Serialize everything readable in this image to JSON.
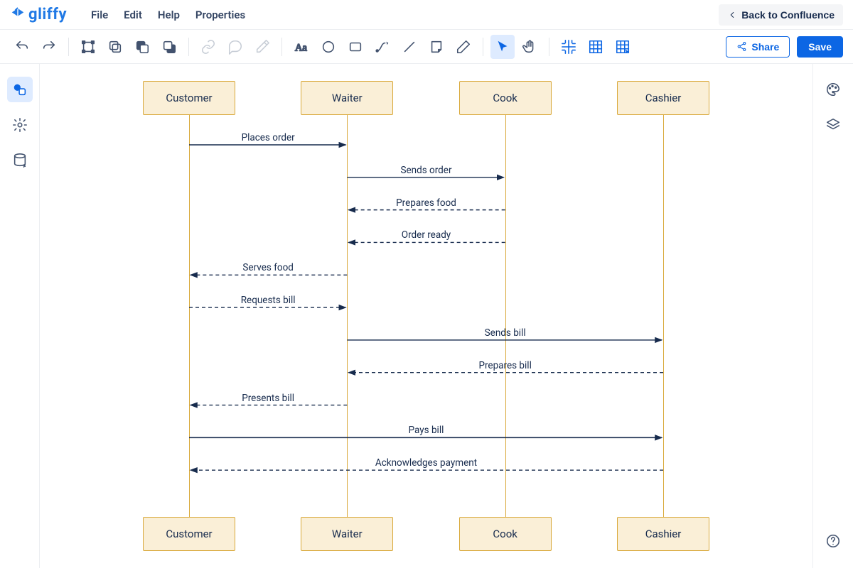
{
  "app": {
    "name": "gliffy"
  },
  "menubar": {
    "items": [
      "File",
      "Edit",
      "Help",
      "Properties"
    ],
    "back": "Back to Confluence"
  },
  "toolbar": {
    "share": "Share",
    "save": "Save"
  },
  "diagram": {
    "participants": [
      "Customer",
      "Waiter",
      "Cook",
      "Cashier"
    ],
    "messages": [
      {
        "from": 0,
        "to": 1,
        "label": "Places order",
        "dashed": false
      },
      {
        "from": 1,
        "to": 2,
        "label": "Sends order",
        "dashed": false
      },
      {
        "from": 2,
        "to": 1,
        "label": "Prepares food",
        "dashed": true
      },
      {
        "from": 2,
        "to": 1,
        "label": "Order ready",
        "dashed": true
      },
      {
        "from": 1,
        "to": 0,
        "label": "Serves food",
        "dashed": true
      },
      {
        "from": 0,
        "to": 1,
        "label": "Requests bill",
        "dashed": true
      },
      {
        "from": 1,
        "to": 3,
        "label": "Sends bill",
        "dashed": false
      },
      {
        "from": 3,
        "to": 1,
        "label": "Prepares bill",
        "dashed": true
      },
      {
        "from": 1,
        "to": 0,
        "label": "Presents bill",
        "dashed": true
      },
      {
        "from": 0,
        "to": 3,
        "label": "Pays bill",
        "dashed": false
      },
      {
        "from": 3,
        "to": 0,
        "label": "Acknowledges payment",
        "dashed": true
      }
    ]
  }
}
